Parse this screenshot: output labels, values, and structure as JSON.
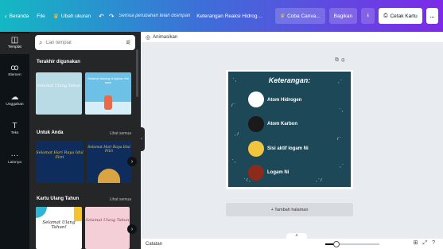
{
  "topbar": {
    "home": "Beranda",
    "file": "File",
    "resize": "Ubah ukuran",
    "undo_icon": "undo-icon",
    "redo_icon": "redo-icon",
    "save_note": "Semua perubahan telah disimpan",
    "doc_title": "Keterangan Reaksi Hidrogenasi",
    "try_pro": "Coba Canva...",
    "share": "Bagikan",
    "download_icon": "download-icon",
    "print_cards": "Cetak Kartu",
    "more": "...",
    "gradient_start": "#14b8c4",
    "gradient_end": "#7d2ae8"
  },
  "rail": {
    "items": [
      {
        "label": "Templat",
        "icon": "template-icon"
      },
      {
        "label": "Elemen",
        "icon": "shapes-icon"
      },
      {
        "label": "Unggahan",
        "icon": "upload-icon"
      },
      {
        "label": "Teks",
        "icon": "text-icon"
      },
      {
        "label": "Lainnya",
        "icon": "more-icon"
      }
    ]
  },
  "panel": {
    "search_placeholder": "Cari templat",
    "recent_title": "Terakhir digunakan",
    "for_you_title": "Untuk Anda",
    "for_you_see_all": "Lihat semua",
    "birthday_title": "Kartu Ulang Tahun",
    "birthday_see_all": "Lihat semua",
    "thumbs": {
      "recent_1": "Selamat Ulang Tahun",
      "recent_2": "Selamat datang di jajaran tim kami",
      "foryou_1": "Selamat Hari Raya Idul Fitri",
      "foryou_2": "Selamat Hari Raya Idul Fitri",
      "bday_1": "Selamat Ulang Tahun!",
      "bday_2": "Selamat Ulang Tahun"
    }
  },
  "editor": {
    "animate": "Animasikan",
    "add_page": "+ Tambah halaman",
    "notes": "Catatan"
  },
  "card": {
    "title": "Keterangan:",
    "background": "#1c4857",
    "legend": [
      {
        "label": "Atom Hidrogen",
        "color": "#ffffff"
      },
      {
        "label": "Atom Karbon",
        "color": "#1a1a1a"
      },
      {
        "label": "Sisi aktif logam Ni",
        "color": "#f2c440"
      },
      {
        "label": "Logam Ni",
        "color": "#8c2a1c"
      }
    ]
  },
  "zoom": {
    "level_fraction": 0.2
  }
}
